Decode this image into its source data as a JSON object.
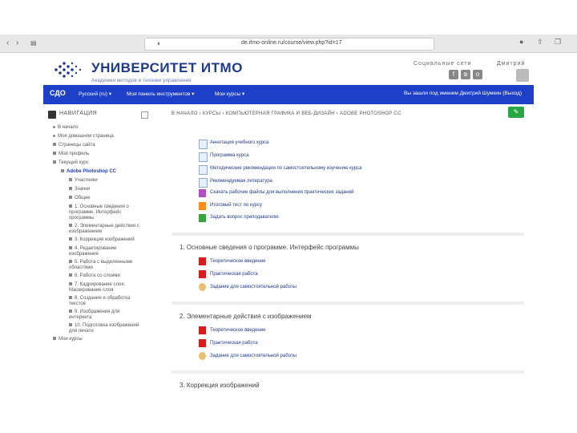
{
  "browser": {
    "url": "de.ifmo-online.ru/course/view.php?id=17"
  },
  "header": {
    "title": "УНИВЕРСИТЕТ ИТМО",
    "subtitle": "Академия методов и техники управления",
    "social_label": "Социальные сети",
    "user": "Дмитрий"
  },
  "navbar": {
    "brand": "СДО",
    "items": [
      "Русский (ru) ▾",
      "Моя панель инструментов ▾",
      "Мои курсы ▾"
    ],
    "login": "Вы зашли под именем Дмитрий Шумкин (Выход)"
  },
  "sidebar": {
    "title": "НАВИГАЦИЯ",
    "items": [
      "В начало",
      "Моя домашняя страница",
      "Страницы сайта",
      "Мой профиль",
      "Текущий курс",
      "Adobe Photoshop CC",
      "Участники",
      "Значки",
      "Общее",
      "1. Основные сведения о",
      "программе. Интерфейс",
      "программы",
      "2. Элементарные действия с",
      "изображением",
      "3. Коррекция изображений",
      "4. Редактирование",
      "изображения",
      "5. Работа с выделенными",
      "областями",
      "6. Работа со слоями",
      "7. Кадрирование слоя.",
      "Маскирование слоя",
      "8. Создание и обработка",
      "текстов",
      "9. Изображения для",
      "интернета",
      "10. Подготовка изображений",
      "для печати",
      "Мои курсы"
    ]
  },
  "breadcrumb": "В НАЧАЛО  ›  КУРСЫ  ›  КОМПЬЮТЕРНАЯ ГРАФИКА И ВЕБ-ДИЗАЙН  ›  ADOBE PHOTOSHOP CC",
  "resources": [
    "Аннотация учебного курса",
    "Программа курса",
    "Методические рекомендации по самостоятельному изучению курса",
    "Рекомендуемая литература",
    "Скачать рабочие файлы для выполнения практических заданий",
    "Итоговый тест по курсу",
    "Задать вопрос преподавателю"
  ],
  "sections": [
    {
      "title": "1. Основные сведения о программе. Интерфейс программы",
      "items": [
        "Теоретическое введение",
        "Практическая работа",
        "Задание для самостоятельной работы"
      ]
    },
    {
      "title": "2. Элементарные действия с изображением",
      "items": [
        "Теоретическое введение",
        "Практическая работа",
        "Задание для самостоятельной работы"
      ]
    },
    {
      "title": "3. Коррекция изображений",
      "items": []
    }
  ]
}
